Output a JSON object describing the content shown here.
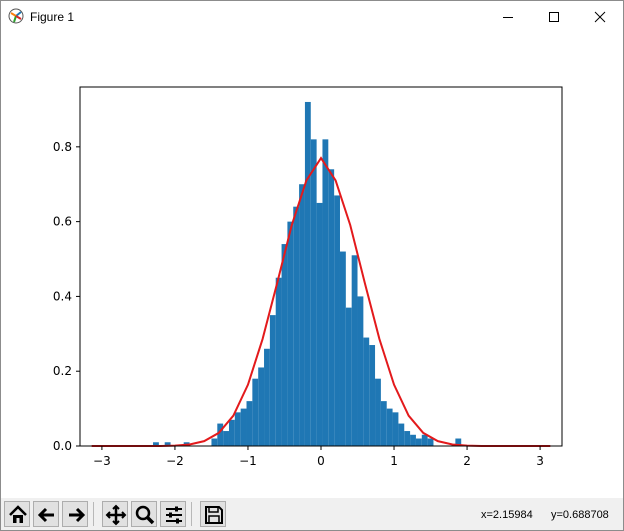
{
  "window": {
    "title": "Figure 1"
  },
  "toolbar": {
    "buttons": [
      {
        "name": "home-icon"
      },
      {
        "name": "back-icon"
      },
      {
        "name": "forward-icon"
      },
      {
        "name": "pan-icon"
      },
      {
        "name": "zoom-icon"
      },
      {
        "name": "configure-subplots-icon"
      },
      {
        "name": "save-icon"
      }
    ],
    "x_readout": "x=2.15984",
    "y_readout": "y=0.688708"
  },
  "chart_data": {
    "type": "bar",
    "title": "",
    "xlabel": "",
    "ylabel": "",
    "xlim": [
      -3.3,
      3.3
    ],
    "ylim": [
      0,
      0.96
    ],
    "xticks": [
      -3,
      -2,
      -1,
      0,
      1,
      2,
      3
    ],
    "xtick_labels": [
      "−3",
      "−2",
      "−1",
      "0",
      "1",
      "2",
      "3"
    ],
    "yticks": [
      0,
      0.2,
      0.4,
      0.6,
      0.8
    ],
    "ytick_labels": [
      "0.0",
      "0.2",
      "0.4",
      "0.6",
      "0.8"
    ],
    "bar_color": "#1f77b4",
    "curve_color": "#e31a1c",
    "histogram": {
      "bin_width": 0.08,
      "bins_start": [
        -2.3,
        -2.14,
        -1.88,
        -1.5,
        -1.42,
        -1.34,
        -1.26,
        -1.18,
        -1.1,
        -1.02,
        -0.94,
        -0.86,
        -0.78,
        -0.7,
        -0.62,
        -0.54,
        -0.46,
        -0.38,
        -0.3,
        -0.22,
        -0.14,
        -0.06,
        0.02,
        0.1,
        0.18,
        0.26,
        0.34,
        0.42,
        0.5,
        0.58,
        0.66,
        0.74,
        0.82,
        0.9,
        0.98,
        1.06,
        1.14,
        1.22,
        1.3,
        1.38,
        1.46,
        1.84
      ],
      "density": [
        0.01,
        0.01,
        0.01,
        0.02,
        0.06,
        0.04,
        0.07,
        0.09,
        0.1,
        0.12,
        0.18,
        0.21,
        0.26,
        0.35,
        0.45,
        0.54,
        0.6,
        0.64,
        0.7,
        0.92,
        0.82,
        0.65,
        0.82,
        0.74,
        0.67,
        0.52,
        0.37,
        0.51,
        0.4,
        0.29,
        0.27,
        0.18,
        0.12,
        0.1,
        0.09,
        0.06,
        0.04,
        0.03,
        0.02,
        0.03,
        0.02,
        0.02
      ]
    },
    "curve": {
      "x": [
        -3.14,
        -3.0,
        -2.8,
        -2.6,
        -2.4,
        -2.2,
        -2.0,
        -1.8,
        -1.6,
        -1.4,
        -1.2,
        -1.0,
        -0.8,
        -0.6,
        -0.4,
        -0.2,
        0.0,
        0.2,
        0.4,
        0.6,
        0.8,
        1.0,
        1.2,
        1.4,
        1.6,
        1.8,
        2.0,
        2.2,
        2.4,
        2.6,
        2.8,
        3.0,
        3.14
      ],
      "y": [
        0.0,
        0.0,
        0.0,
        0.0,
        0.0,
        0.0,
        0.001,
        0.004,
        0.013,
        0.035,
        0.081,
        0.164,
        0.286,
        0.436,
        0.591,
        0.71,
        0.77,
        0.71,
        0.591,
        0.436,
        0.286,
        0.164,
        0.081,
        0.035,
        0.013,
        0.004,
        0.001,
        0.0,
        0.0,
        0.0,
        0.0,
        0.0,
        0.0
      ]
    }
  }
}
